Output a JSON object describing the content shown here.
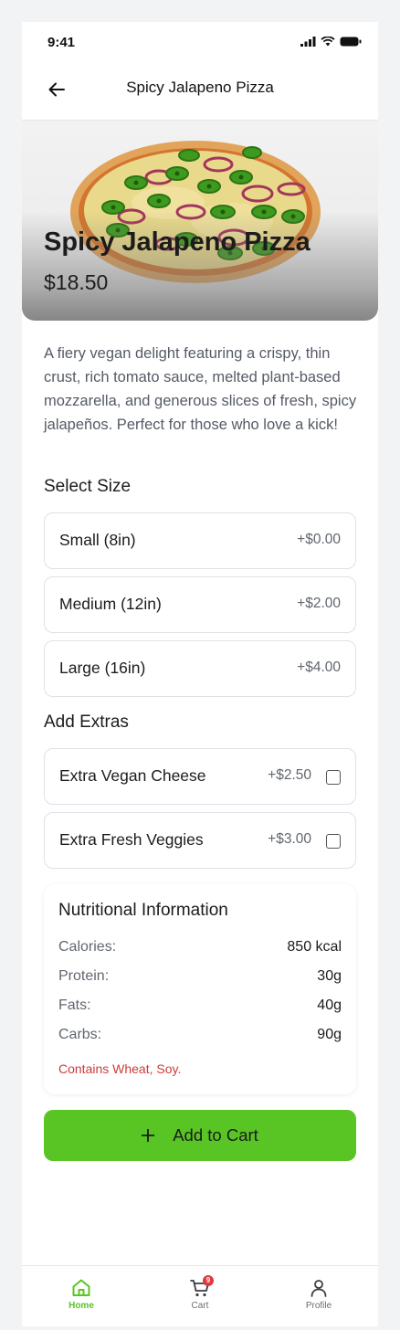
{
  "status_bar": {
    "time": "9:41"
  },
  "header": {
    "title": "Spicy Jalapeno Pizza"
  },
  "product": {
    "name": "Spicy Jalapeno Pizza",
    "price": "$18.50",
    "description": "A fiery vegan delight featuring a crispy, thin crust, rich tomato sauce, melted plant-based mozzarella, and generous slices of fresh, spicy jalapeños. Perfect for those who love a kick!"
  },
  "size_section": {
    "title": "Select Size",
    "options": [
      {
        "label": "Small (8in)",
        "price": "+$0.00"
      },
      {
        "label": "Medium (12in)",
        "price": "+$2.00"
      },
      {
        "label": "Large (16in)",
        "price": "+$4.00"
      }
    ]
  },
  "extras_section": {
    "title": "Add Extras",
    "options": [
      {
        "label": "Extra Vegan Cheese",
        "price": "+$2.50",
        "checked": false
      },
      {
        "label": "Extra Fresh Veggies",
        "price": "+$3.00",
        "checked": false
      }
    ]
  },
  "nutrition": {
    "title": "Nutritional Information",
    "rows": [
      {
        "label": "Calories:",
        "value": "850 kcal"
      },
      {
        "label": "Protein:",
        "value": "30g"
      },
      {
        "label": "Fats:",
        "value": "40g"
      },
      {
        "label": "Carbs:",
        "value": "90g"
      }
    ],
    "allergens": "Contains Wheat, Soy."
  },
  "cta": {
    "label": "Add to Cart",
    "icon": "plus-icon"
  },
  "bottom_nav": {
    "items": [
      {
        "label": "Home",
        "icon": "home-icon",
        "active": true
      },
      {
        "label": "Cart",
        "icon": "cart-icon",
        "badge": "9"
      },
      {
        "label": "Profile",
        "icon": "profile-icon"
      }
    ]
  },
  "colors": {
    "accent": "#58c524",
    "badge": "#e0383e",
    "allergen_text": "#d03a3a",
    "border": "#dfe1e6"
  }
}
